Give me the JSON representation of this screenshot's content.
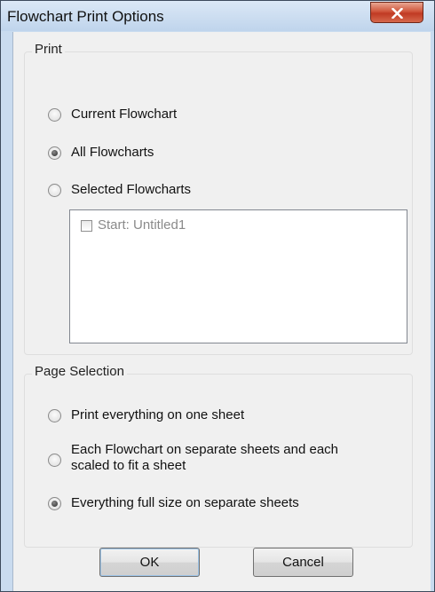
{
  "window": {
    "title": "Flowchart Print Options"
  },
  "print_group": {
    "label": "Print",
    "options": [
      {
        "label": "Current Flowchart",
        "selected": false
      },
      {
        "label": "All Flowcharts",
        "selected": true
      },
      {
        "label": "Selected Flowcharts",
        "selected": false
      }
    ],
    "flowchart_list": [
      {
        "label": "Start: Untitled1",
        "checked": false
      }
    ]
  },
  "page_group": {
    "label": "Page Selection",
    "options": [
      {
        "label": "Print everything on one sheet",
        "selected": false
      },
      {
        "label_line1": "Each Flowchart on separate sheets and each",
        "label_line2": "scaled to fit a sheet",
        "selected": false
      },
      {
        "label": "Everything full size on separate sheets",
        "selected": true
      }
    ]
  },
  "buttons": {
    "ok": "OK",
    "cancel": "Cancel"
  },
  "colors": {
    "titlebar": "#c9dbef",
    "close": "#c94a30",
    "client": "#f0f0f0"
  }
}
